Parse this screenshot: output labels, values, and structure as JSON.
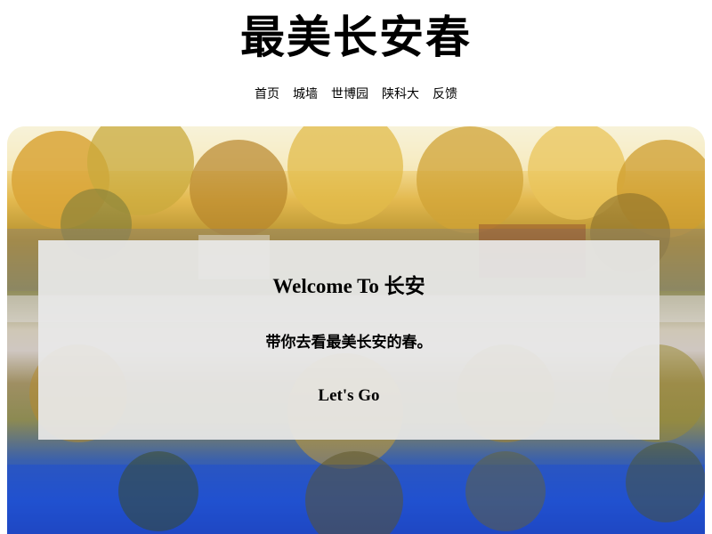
{
  "header": {
    "title": "最美长安春"
  },
  "nav": {
    "items": [
      {
        "label": "首页"
      },
      {
        "label": "城墙"
      },
      {
        "label": "世博园"
      },
      {
        "label": "陕科大"
      },
      {
        "label": "反馈"
      }
    ]
  },
  "hero": {
    "heading": "Welcome To 长安",
    "subtitle": "带你去看最美长安的春。",
    "button_label": "Let's Go"
  },
  "colors": {
    "sky": "#f7f3d9",
    "foliage": "#e3b94f",
    "water": "#2355d0",
    "panel": "#e8e8e8"
  }
}
